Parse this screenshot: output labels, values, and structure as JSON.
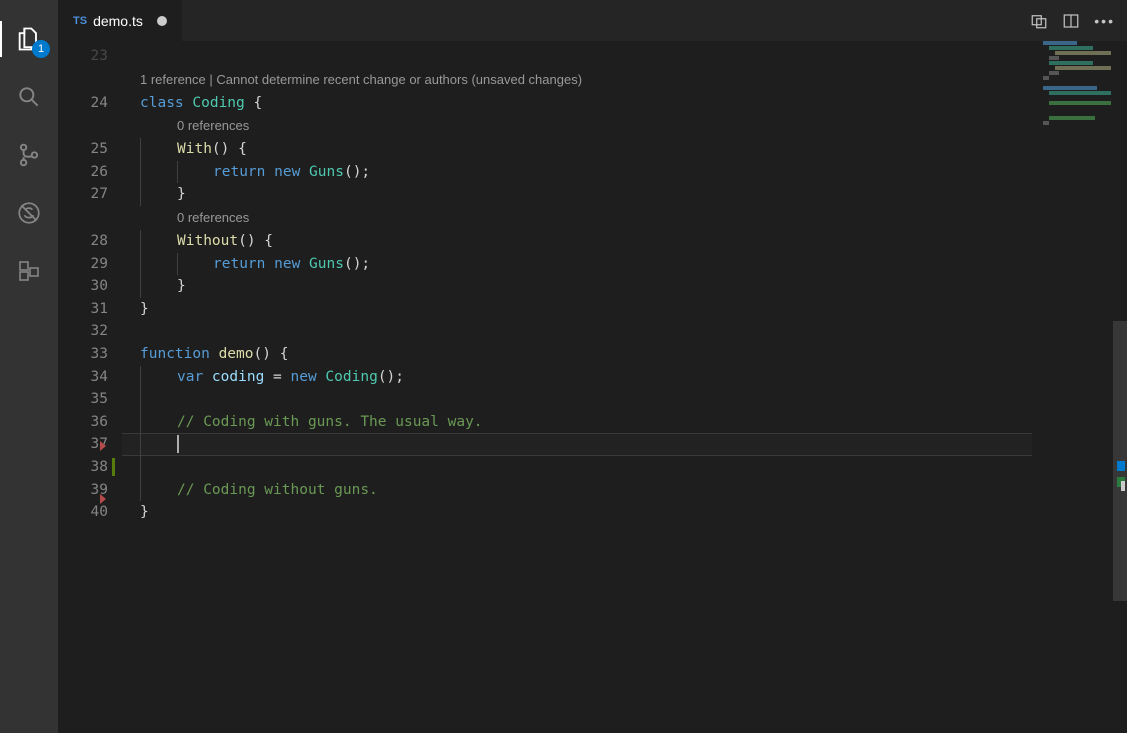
{
  "activity": {
    "badge": "1"
  },
  "tabbar": {
    "ts_label": "TS",
    "filename": "demo.ts"
  },
  "gutter": {
    "codelens_blank1": "23",
    "lines": [
      "24",
      "25",
      "26",
      "27",
      "28",
      "29",
      "30",
      "31",
      "32",
      "33",
      "34",
      "35",
      "36",
      "37",
      "38",
      "39",
      "40"
    ]
  },
  "codelens1": "1 reference | Cannot determine recent change or authors (unsaved changes)",
  "codelens2": "0 references",
  "codelens3": "0 references",
  "lines": {
    "l24_class": "class",
    "l24_type": " Coding",
    "l24_tail": " {",
    "l25_name": "With",
    "l25_tail": "() {",
    "l26_return": "return",
    "l26_new": " new",
    "l26_type": " Guns",
    "l26_tail": "();",
    "l27": "}",
    "l28_name": "Without",
    "l28_tail": "() {",
    "l29_return": "return",
    "l29_new": " new",
    "l29_type": " Guns",
    "l29_tail": "();",
    "l30": "}",
    "l31": "}",
    "l33_fn": "function",
    "l33_name": " demo",
    "l33_tail": "() {",
    "l34_var": "var",
    "l34_id": " coding",
    "l34_eq": " =",
    "l34_new": " new",
    "l34_type": " Coding",
    "l34_tail": "();",
    "l36_comment": "// Coding with guns. The usual way.",
    "l39_comment": "// Coding without guns.",
    "l40": "}"
  }
}
